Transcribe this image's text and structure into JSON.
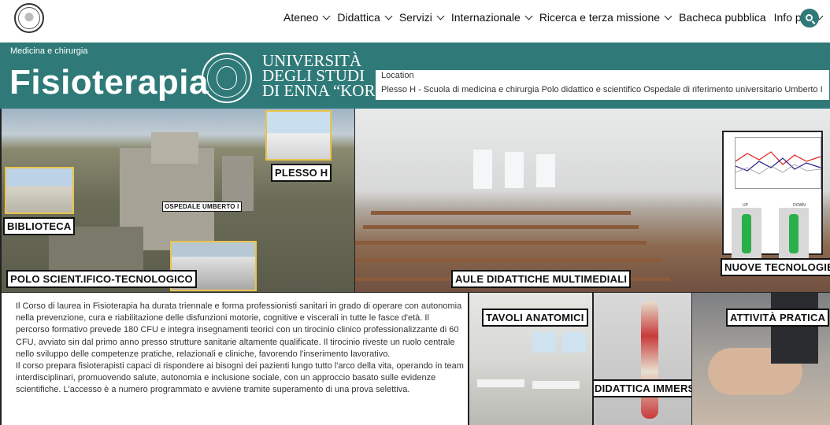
{
  "nav": {
    "items": [
      {
        "label": "Ateneo",
        "dropdown": true
      },
      {
        "label": "Didattica",
        "dropdown": true
      },
      {
        "label": "Servizi",
        "dropdown": true
      },
      {
        "label": "Internazionale",
        "dropdown": true
      },
      {
        "label": "Ricerca e terza missione",
        "dropdown": true
      },
      {
        "label": "Bacheca pubblica",
        "dropdown": false
      },
      {
        "label": "Info per",
        "dropdown": true
      }
    ],
    "search_icon": "search-icon"
  },
  "hero": {
    "breadcrumb": "Medicina e chirurgia",
    "title": "Fisioterapia",
    "university_line1": "UNIVERSITÀ",
    "university_line2": "DEGLI STUDI",
    "university_line3": "DI ENNA “KORE”",
    "location_label": "Location",
    "location_value": "Plesso H - Scuola di medicina e chirurgia Polo didattico e scientifico Ospedale di riferimento universitario Umberto I"
  },
  "gallery": {
    "plesso_h": "PLESSO H",
    "ospedale": "OSPEDALE UMBERTO I",
    "biblioteca": "BIBLIOTECA",
    "polo": "POLO SCIENT.IFICO-TECNOLOGICO",
    "aule": "AULE DIDATTICHE MULTIMEDIALI",
    "nuove": "NUOVE TECNOLOGIE",
    "tavoli": "TAVOLI ANATOMICI",
    "attivita": "ATTIVITÀ PRATICA",
    "immersiva": "DIDATTICA IMMERSIVA",
    "fig_label_left": "UP",
    "fig_label_right": "DOWN"
  },
  "description": {
    "p1": "Il Corso di laurea in Fisioterapia ha durata triennale e forma professionisti sanitari in grado di operare con autonomia nella prevenzione, cura e riabilitazione delle disfunzioni motorie, cognitive e viscerali in tutte le fasce d'età. Il percorso formativo prevede 180 CFU e integra insegnamenti teorici con un tirocinio clinico professionalizzante di 60 CFU, avviato sin dal primo anno presso strutture sanitarie altamente qualificate. Il tirocinio riveste un ruolo centrale nello sviluppo delle competenze pratiche, relazionali e cliniche, favorendo l'inserimento lavorativo.",
    "p2": "Il corso prepara fisioterapisti capaci di rispondere ai bisogni dei pazienti lungo tutto l'arco della vita, operando in team interdisciplinari, promuovendo salute, autonomia e inclusione sociale, con un approccio basato sulle evidenze scientifiche. L'accesso è a numero programmato e avviene tramite superamento di una prova selettiva."
  },
  "colors": {
    "brand": "#2f7a78",
    "tag_border": "#111111",
    "inset_border": "#e9c44a"
  }
}
